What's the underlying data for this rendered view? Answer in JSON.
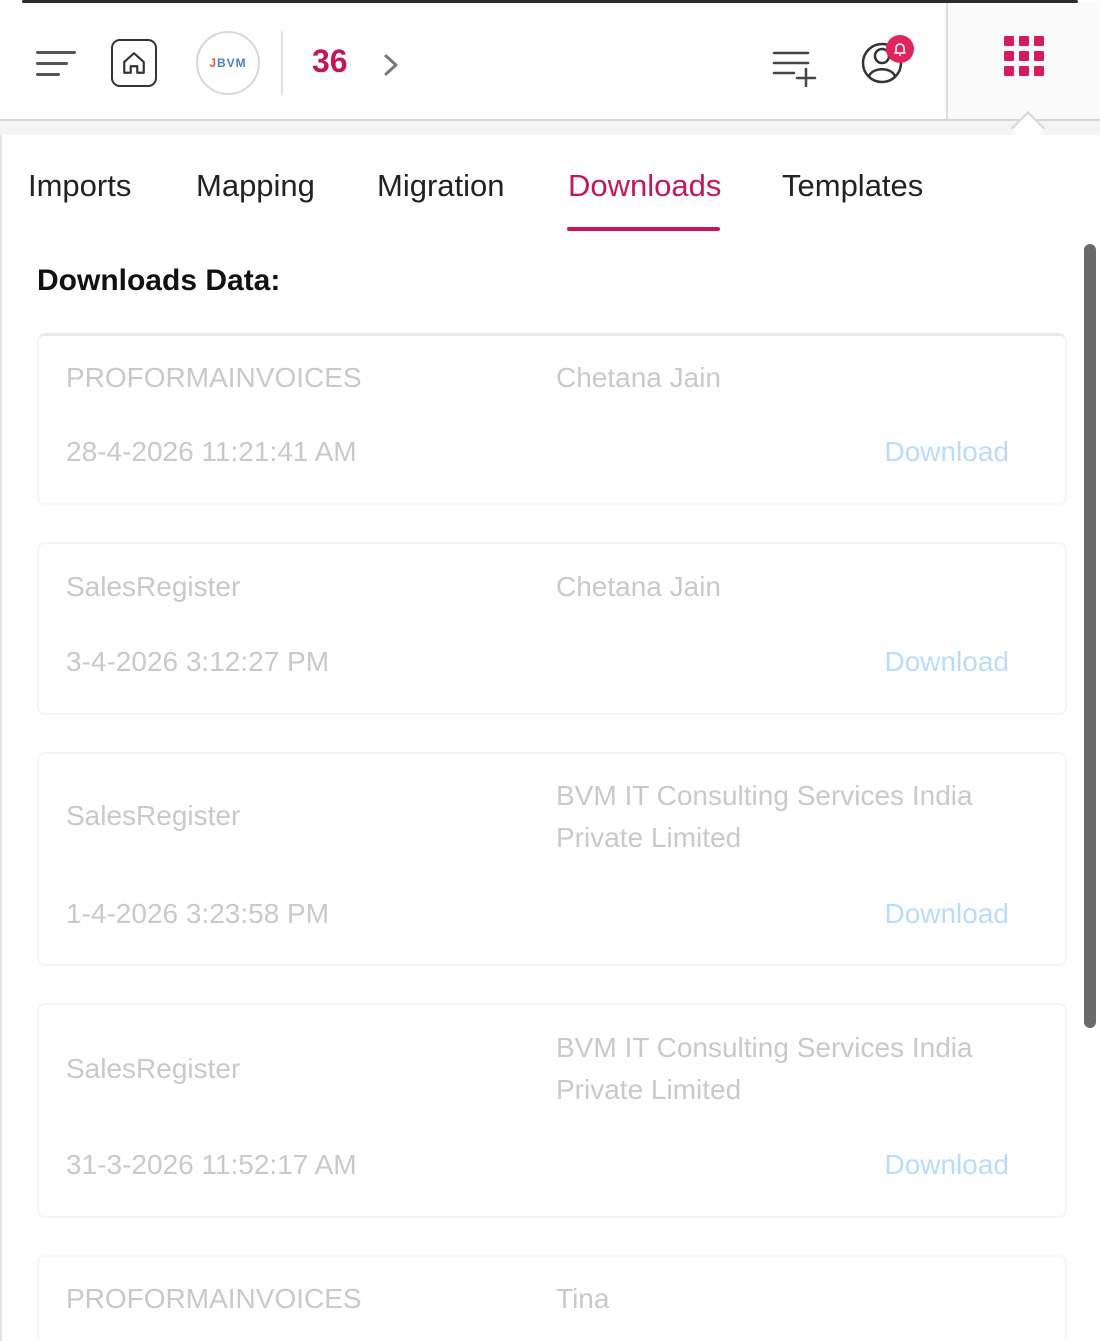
{
  "header": {
    "count": "36",
    "logo_text": "BVM"
  },
  "tabs": [
    {
      "label": "Imports"
    },
    {
      "label": "Mapping"
    },
    {
      "label": "Migration"
    },
    {
      "label": "Downloads",
      "active": true
    },
    {
      "label": "Templates"
    }
  ],
  "section_title": "Downloads Data:",
  "downloads": [
    {
      "type": "PROFORMAINVOICES",
      "user": "Chetana Jain",
      "date": "28-4-2026 11:21:41 AM",
      "action": "Download"
    },
    {
      "type": "SalesRegister",
      "user": "Chetana Jain",
      "date": "3-4-2026 3:12:27 PM",
      "action": "Download"
    },
    {
      "type": "SalesRegister",
      "user": "BVM IT Consulting Services India Private Limited",
      "date": "1-4-2026 3:23:58 PM",
      "action": "Download"
    },
    {
      "type": "SalesRegister",
      "user": "BVM IT Consulting Services India Private Limited",
      "date": "31-3-2026 11:52:17 AM",
      "action": "Download"
    },
    {
      "type": "PROFORMAINVOICES",
      "user": "Tina"
    }
  ],
  "colors": {
    "accent": "#c2185b",
    "notification": "#e0245e",
    "link": "#64b5f6"
  }
}
